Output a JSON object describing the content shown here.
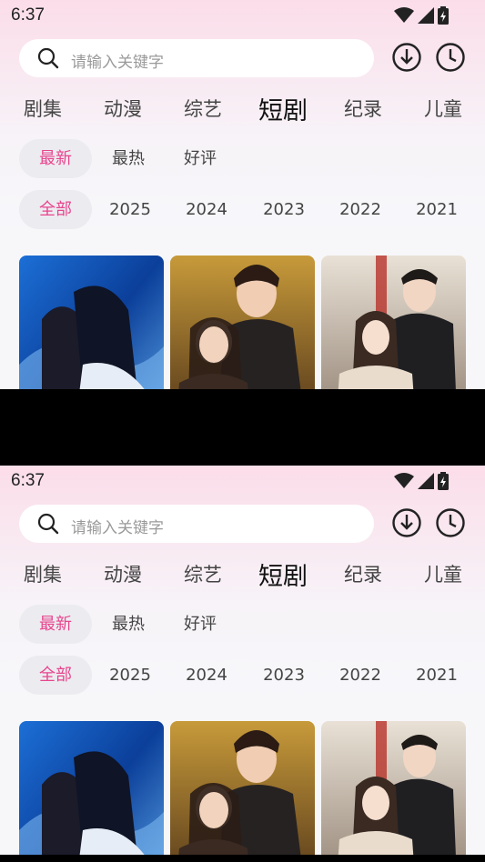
{
  "status_bar": {
    "time": "6:37"
  },
  "search": {
    "placeholder": "请输入关键字"
  },
  "category_tabs": [
    {
      "label": "剧集",
      "active": false
    },
    {
      "label": "动漫",
      "active": false
    },
    {
      "label": "综艺",
      "active": false
    },
    {
      "label": "短剧",
      "active": true
    },
    {
      "label": "纪录",
      "active": false
    },
    {
      "label": "儿童",
      "active": false
    }
  ],
  "sort_filters": [
    {
      "label": "最新",
      "active": true
    },
    {
      "label": "最热",
      "active": false
    },
    {
      "label": "好评",
      "active": false
    }
  ],
  "year_filters": [
    {
      "label": "全部",
      "active": true
    },
    {
      "label": "2025",
      "active": false
    },
    {
      "label": "2024",
      "active": false
    },
    {
      "label": "2023",
      "active": false
    },
    {
      "label": "2022",
      "active": false
    },
    {
      "label": "2021",
      "active": false
    }
  ],
  "colors": {
    "accent": "#e8458e",
    "chip_bg": "#ececf0",
    "header_gradient_top": "#fbdde9",
    "page_bg": "#f7f7fa"
  },
  "icons": [
    "search-icon",
    "download-icon",
    "history-clock-icon",
    "wifi-icon",
    "signal-icon",
    "battery-icon"
  ],
  "posters": [
    {
      "name": "poster-1"
    },
    {
      "name": "poster-2"
    },
    {
      "name": "poster-3"
    }
  ]
}
